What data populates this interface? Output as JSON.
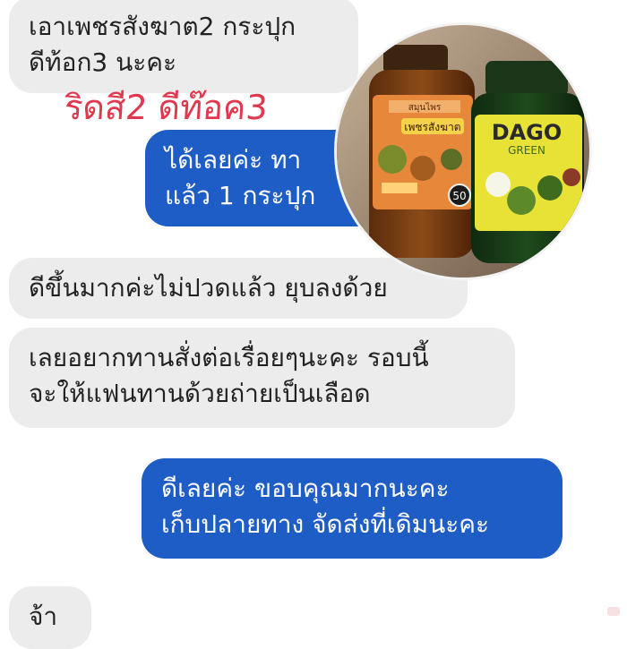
{
  "chat": {
    "messages": [
      {
        "side": "incoming",
        "text": "เอาเพชรสังฆาต2 กระปุก\nดีท้อก3 นะคะ"
      },
      {
        "side": "outgoing",
        "text": "ได้เลยค่ะ  ทา\nแล้ว 1 กระปุก"
      },
      {
        "side": "incoming",
        "text": "ดีขึ้นมากค่ะไม่ปวดแล้ว ยุบลงด้วย"
      },
      {
        "side": "incoming",
        "text": "เลยอยากทานสั่งต่อเรื่อยๆนะคะ รอบนี้\nจะให้แฟนทานด้วยถ่ายเป็นเลือด"
      },
      {
        "side": "outgoing",
        "text": "ดีเลยค่ะ  ขอบคุณมากนะคะ\nเก็บปลายทาง จัดส่งที่เดิมนะคะ"
      },
      {
        "side": "incoming",
        "text": "จ้า"
      }
    ]
  },
  "overlay": {
    "text": "ริดสี2 ดีท๊อค3",
    "color": "#e0384f"
  },
  "product_photo": {
    "bottle1": {
      "label_lines": [
        "สมุนไพร",
        "เพชรสังฆาต"
      ],
      "count": "50"
    },
    "bottle2": {
      "brand": "DAGO",
      "sub": "GREEN"
    }
  },
  "colors": {
    "outgoing_bubble": "#1e5cc6",
    "incoming_bubble": "#ececec"
  }
}
